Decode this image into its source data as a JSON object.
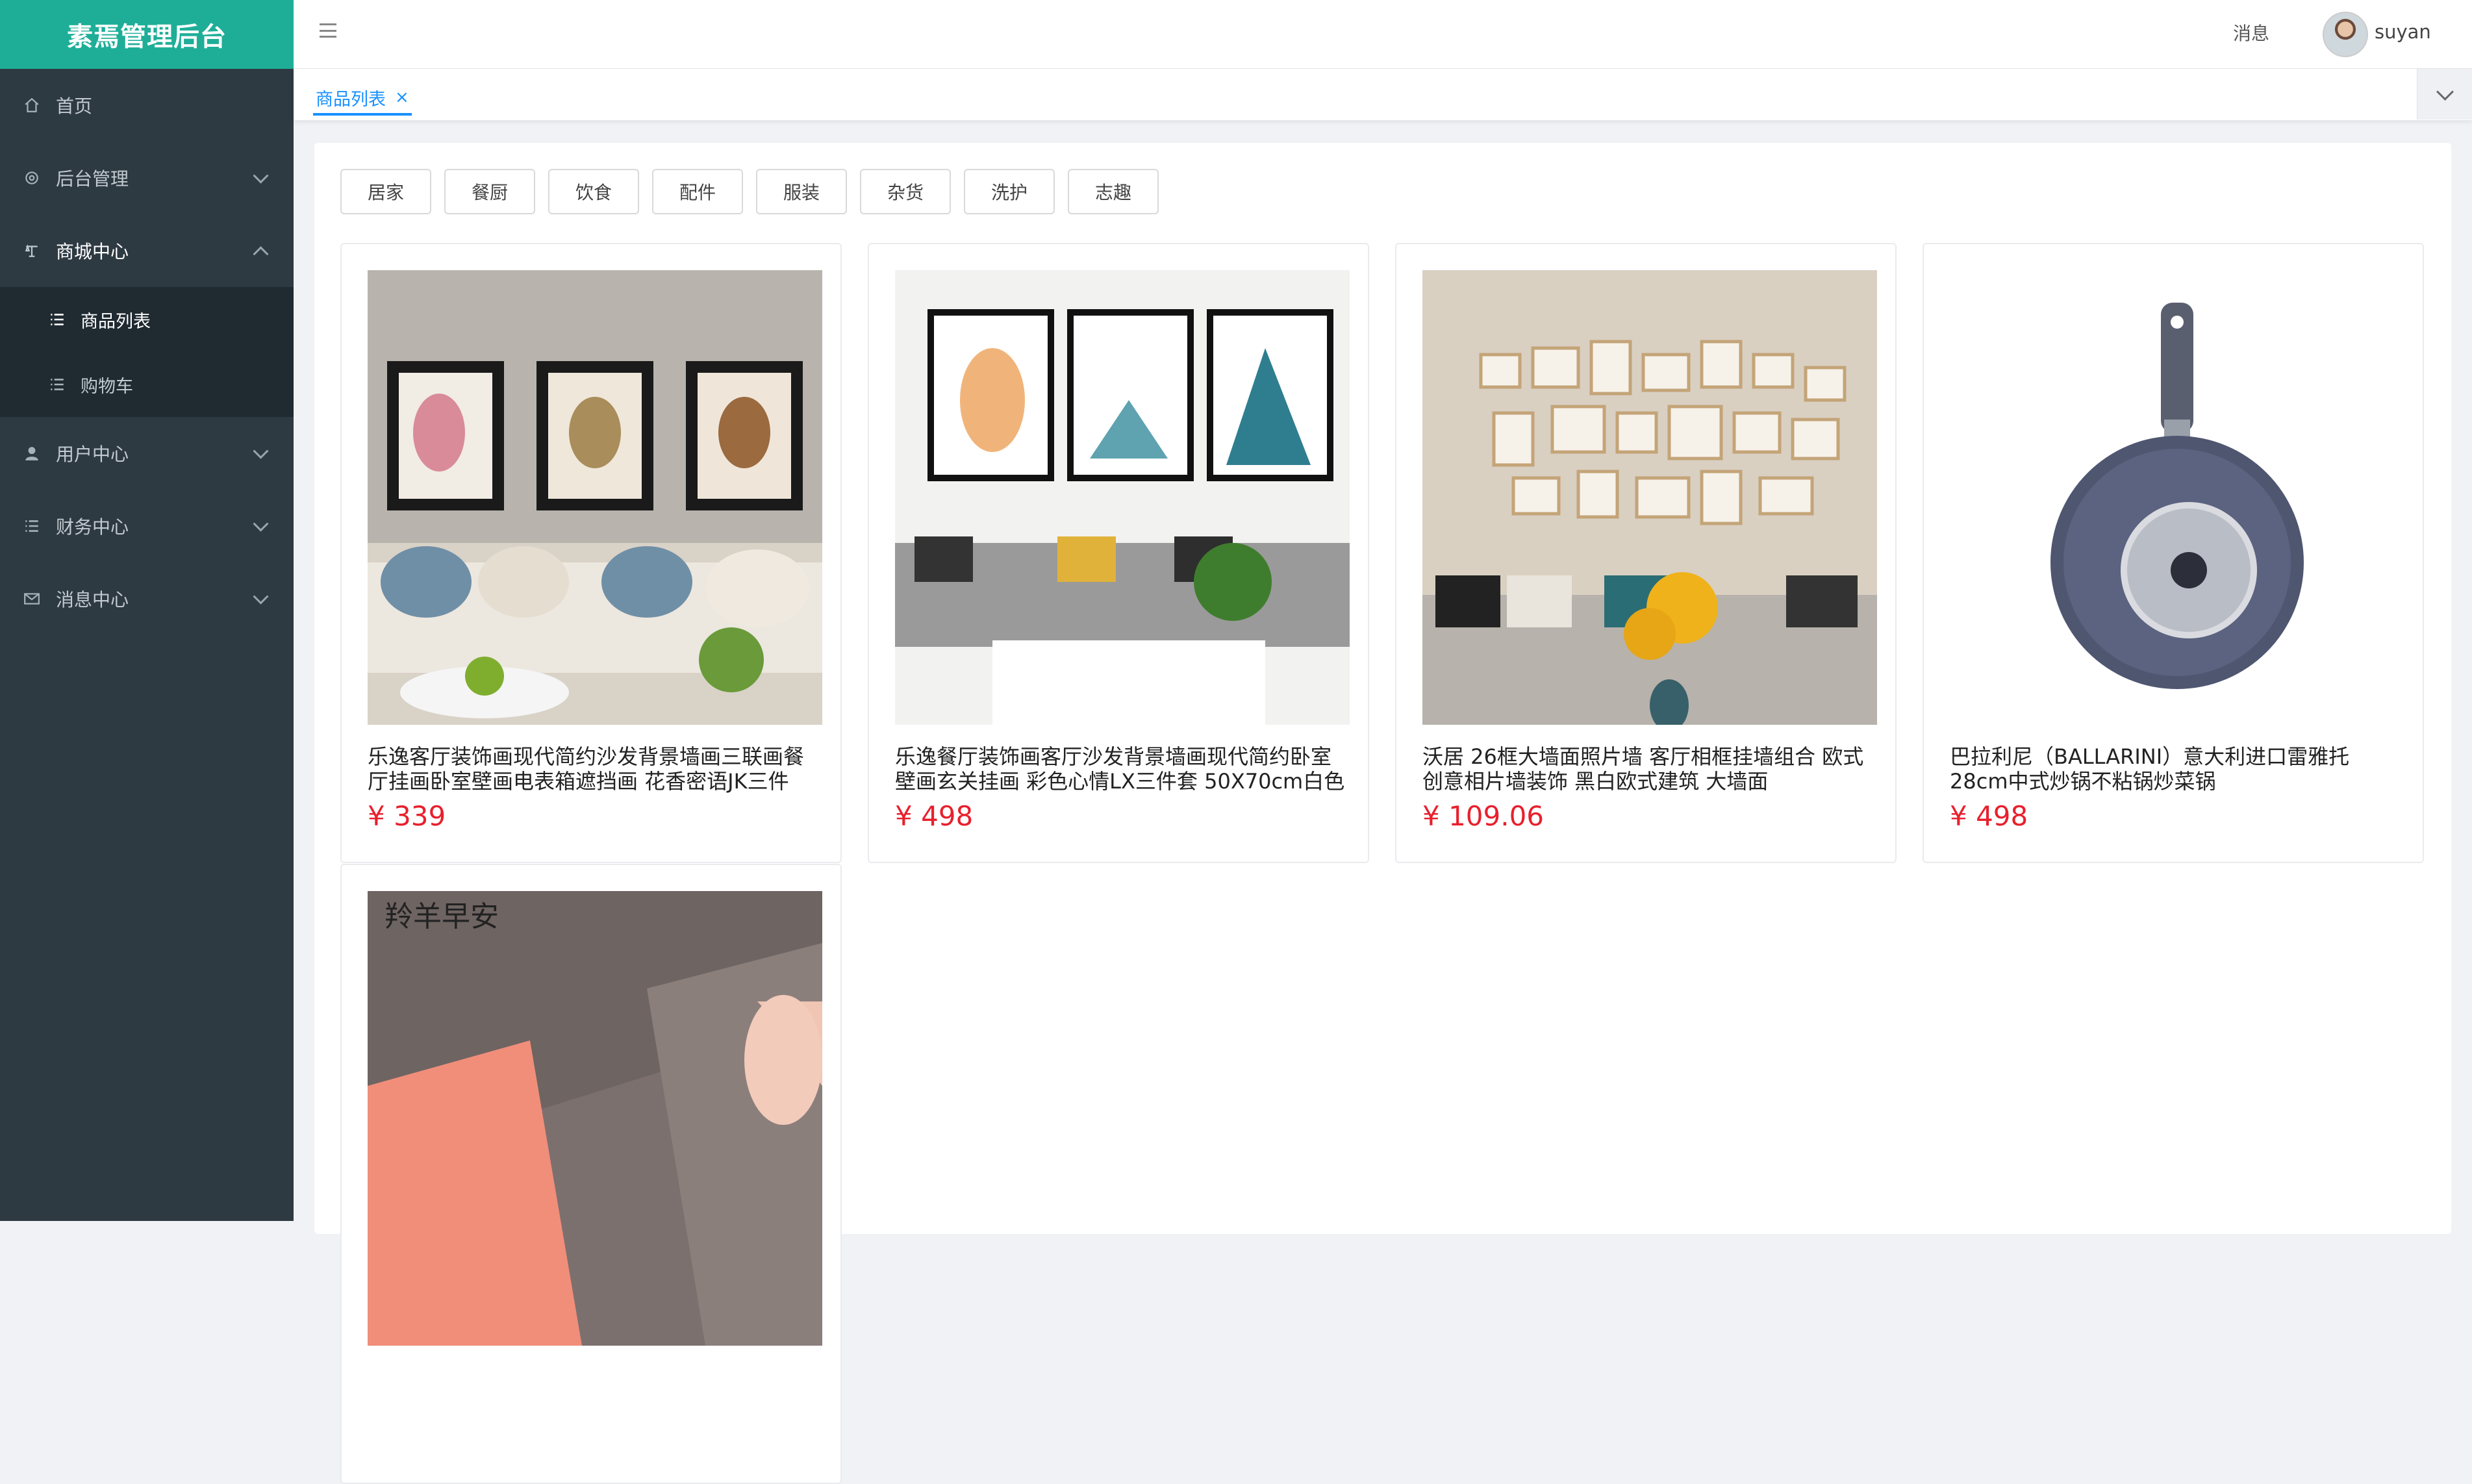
{
  "app": {
    "title": "素焉管理后台"
  },
  "sidebar": {
    "items": [
      {
        "label": "首页",
        "icon": "home-icon"
      },
      {
        "label": "后台管理",
        "icon": "gear-icon"
      },
      {
        "label": "商城中心",
        "icon": "shop-icon",
        "open": true,
        "children": [
          {
            "label": "商品列表",
            "active": true
          },
          {
            "label": "购物车"
          }
        ]
      },
      {
        "label": "用户中心",
        "icon": "user-icon"
      },
      {
        "label": "财务中心",
        "icon": "list-icon"
      },
      {
        "label": "消息中心",
        "icon": "mail-icon"
      }
    ]
  },
  "header": {
    "messages_label": "消息",
    "username": "suyan"
  },
  "tabs": [
    {
      "label": "商品列表",
      "close": "×"
    }
  ],
  "categories": [
    "居家",
    "餐厨",
    "饮食",
    "配件",
    "服装",
    "杂货",
    "洗护",
    "志趣"
  ],
  "products": [
    {
      "title": "乐逸客厅装饰画现代简约沙发背景墙画三联画餐厅挂画卧室壁画电表箱遮挡画 花香密语JK三件",
      "price": "¥ 339"
    },
    {
      "title": "乐逸餐厅装饰画客厅沙发背景墙画现代简约卧室壁画玄关挂画 彩色心情LX三件套 50X70cm白色",
      "price": "¥ 498"
    },
    {
      "title": "沃居 26框大墙面照片墙 客厅相框挂墙组合 欧式创意相片墙装饰 黑白欧式建筑 大墙面",
      "price": "¥ 109.06"
    },
    {
      "title": "巴拉利尼（BALLARINI）意大利进口雷雅托28cm中式炒锅不粘锅炒菜锅",
      "price": "¥ 498"
    },
    {
      "title": "",
      "price": "",
      "brand_mark": "羚羊早安"
    }
  ],
  "colors": {
    "sidebar_bg": "#2e3a42",
    "logo_bg": "#1eae98",
    "accent": "#1890ff",
    "price": "#e8202d"
  }
}
